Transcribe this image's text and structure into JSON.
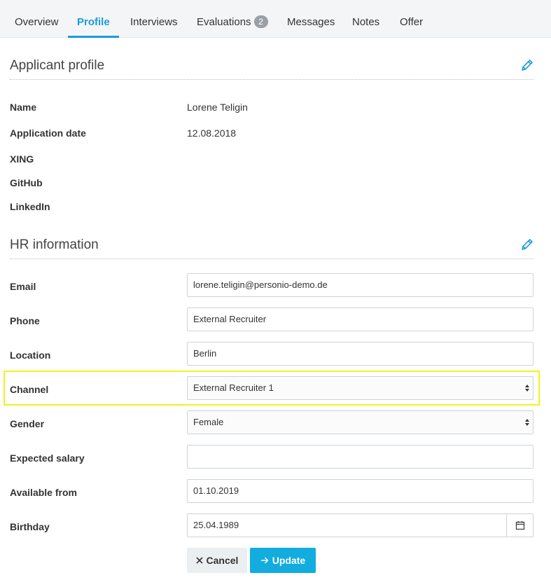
{
  "tabs": [
    {
      "label": "Overview"
    },
    {
      "label": "Profile",
      "active": true
    },
    {
      "label": "Interviews"
    },
    {
      "label": "Evaluations",
      "badge": "2"
    },
    {
      "label": "Messages"
    },
    {
      "label": "Notes"
    },
    {
      "label": "Offer"
    }
  ],
  "applicant_profile": {
    "title": "Applicant profile",
    "edit_icon": "pencil-icon",
    "rows": [
      {
        "label": "Name",
        "value": "Lorene Teligin"
      },
      {
        "label": "Application date",
        "value": "12.08.2018"
      },
      {
        "label": "XING",
        "value": ""
      },
      {
        "label": "GitHub",
        "value": ""
      },
      {
        "label": "LinkedIn",
        "value": ""
      }
    ]
  },
  "hr_information": {
    "title": "HR information",
    "edit_icon": "pencil-icon",
    "fields": {
      "email": {
        "label": "Email",
        "value": "lorene.teligin@personio-demo.de"
      },
      "phone": {
        "label": "Phone",
        "value": "External Recruiter"
      },
      "location": {
        "label": "Location",
        "value": "Berlin"
      },
      "channel": {
        "label": "Channel",
        "value": "External Recruiter 1"
      },
      "gender": {
        "label": "Gender",
        "value": "Female"
      },
      "expected_salary": {
        "label": "Expected salary",
        "value": ""
      },
      "available_from": {
        "label": "Available from",
        "value": "01.10.2019"
      },
      "birthday": {
        "label": "Birthday",
        "value": "25.04.1989"
      }
    }
  },
  "actions": {
    "cancel_label": "Cancel",
    "update_label": "Update"
  },
  "colors": {
    "accent": "#1a9bd7",
    "update_button": "#12acdf",
    "highlight": "#f2f21e",
    "tabbar_bg": "#f3f5f7"
  }
}
